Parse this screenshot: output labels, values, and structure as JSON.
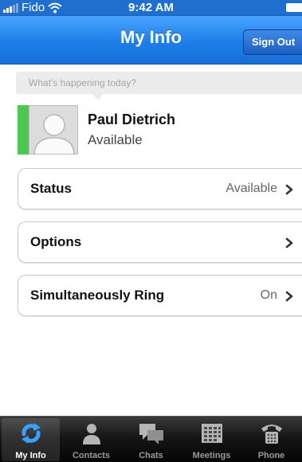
{
  "status_bar": {
    "carrier": "Fido",
    "time": "9:42 AM"
  },
  "nav": {
    "title": "My Info",
    "sign_out_label": "Sign Out"
  },
  "happening": {
    "placeholder": "What's happening today?"
  },
  "profile": {
    "name": "Paul Dietrich",
    "status": "Available",
    "presence_color": "#4cc74f"
  },
  "rows": [
    {
      "label": "Status",
      "value": "Available"
    },
    {
      "label": "Options",
      "value": ""
    },
    {
      "label": "Simultaneously Ring",
      "value": "On"
    }
  ],
  "tabs": [
    {
      "label": "My Info",
      "icon": "sync-arrows-icon",
      "active": true
    },
    {
      "label": "Contacts",
      "icon": "person-icon",
      "active": false
    },
    {
      "label": "Chats",
      "icon": "chat-bubbles-icon",
      "active": false
    },
    {
      "label": "Meetings",
      "icon": "calendar-icon",
      "active": false
    },
    {
      "label": "Phone",
      "icon": "phone-icon",
      "active": false
    }
  ],
  "colors": {
    "nav_blue": "#1e7fe9",
    "presence_green": "#4cc74f",
    "tab_active_icon": "#3aa0ff"
  }
}
